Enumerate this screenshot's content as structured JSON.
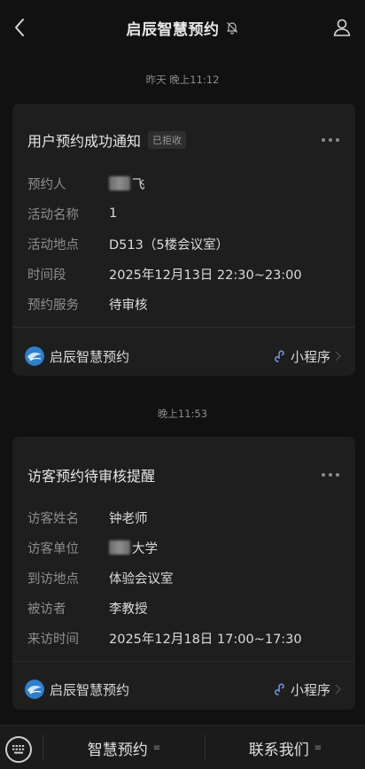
{
  "header": {
    "title": "启辰智慧预约",
    "back_icon": "chevron-left-icon",
    "mute_icon": "bell-muted-icon",
    "profile_icon": "person-icon"
  },
  "messages": [
    {
      "timestamp": "昨天 晚上11:12",
      "title": "用户预约成功通知",
      "badge": "已拒收",
      "rows": [
        {
          "label": "预约人",
          "value": "飞",
          "redacted": true
        },
        {
          "label": "活动名称",
          "value": "1"
        },
        {
          "label": "活动地点",
          "value": "D513（5楼会议室）"
        },
        {
          "label": "时间段",
          "value": "2025年12月13日 22:30~23:00"
        },
        {
          "label": "预约服务",
          "value": "待审核"
        }
      ],
      "footer": {
        "app_name": "启辰智慧预约",
        "link_label": "小程序"
      }
    },
    {
      "timestamp": "晚上11:53",
      "title": "访客预约待审核提醒",
      "rows": [
        {
          "label": "访客姓名",
          "value": "钟老师"
        },
        {
          "label": "访客单位",
          "value": "大学",
          "redacted": true
        },
        {
          "label": "到访地点",
          "value": "体验会议室"
        },
        {
          "label": "被访者",
          "value": "李教授"
        },
        {
          "label": "来访时间",
          "value": "2025年12月18日 17:00~17:30"
        }
      ],
      "footer": {
        "app_name": "启辰智慧预约",
        "link_label": "小程序"
      }
    }
  ],
  "bottom_menu": {
    "keyboard_icon": "keyboard-icon",
    "items": [
      {
        "label": "智慧预约",
        "glyph": "≡"
      },
      {
        "label": "联系我们",
        "glyph": "≡"
      }
    ]
  },
  "colors": {
    "background": "#111111",
    "card": "#1e1e1e",
    "text_primary": "#e6e6e6",
    "text_secondary": "#8e8e8e",
    "link_icon": "#6f8fd8"
  }
}
